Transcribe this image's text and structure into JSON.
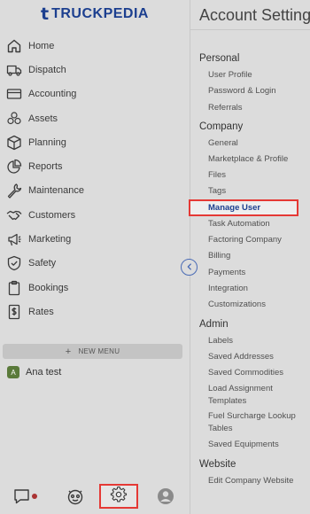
{
  "brand": {
    "mark": "t",
    "name": "TRUCKPEDIA",
    "color": "#1c3f8f"
  },
  "sidebar": {
    "items": [
      {
        "label": "Home",
        "icon": "home-icon"
      },
      {
        "label": "Dispatch",
        "icon": "truck-icon"
      },
      {
        "label": "Accounting",
        "icon": "card-icon"
      },
      {
        "label": "Assets",
        "icon": "assets-icon"
      },
      {
        "label": "Planning",
        "icon": "box-icon"
      },
      {
        "label": "Reports",
        "icon": "pie-chart-icon"
      },
      {
        "label": "Maintenance",
        "icon": "wrench-icon"
      },
      {
        "label": "Customers",
        "icon": "handshake-icon"
      },
      {
        "label": "Marketing",
        "icon": "megaphone-icon"
      },
      {
        "label": "Safety",
        "icon": "shield-check-icon"
      },
      {
        "label": "Bookings",
        "icon": "clipboard-icon"
      },
      {
        "label": "Rates",
        "icon": "dollar-doc-icon"
      }
    ],
    "new_menu_label": "NEW MENU",
    "workspace": {
      "initial": "A",
      "name": "Ana test"
    }
  },
  "bottom_bar": {
    "items": [
      "chat-icon",
      "bot-icon",
      "gear-icon",
      "user-avatar-icon"
    ],
    "active": "gear-icon"
  },
  "panel": {
    "title": "Account Settings",
    "sections": [
      {
        "heading": "Personal",
        "links": [
          "User Profile",
          "Password & Login",
          "Referrals"
        ]
      },
      {
        "heading": "Company",
        "links": [
          "General",
          "Marketplace & Profile",
          "Files",
          "Tags",
          "Manage User",
          "Task Automation",
          "Factoring Company",
          "Billing",
          "Payments",
          "Integration",
          "Customizations"
        ]
      },
      {
        "heading": "Admin",
        "links": [
          "Labels",
          "Saved Addresses",
          "Saved Commodities",
          "Load Assignment Templates",
          "Fuel Surcharge Lookup Tables",
          "Saved Equipments"
        ]
      },
      {
        "heading": "Website",
        "links": [
          "Edit Company Website"
        ]
      }
    ],
    "active_link": "Manage User"
  },
  "colors": {
    "background": "#dcdcdc",
    "accent": "#1c3f8f",
    "highlight_border": "#e53935"
  }
}
